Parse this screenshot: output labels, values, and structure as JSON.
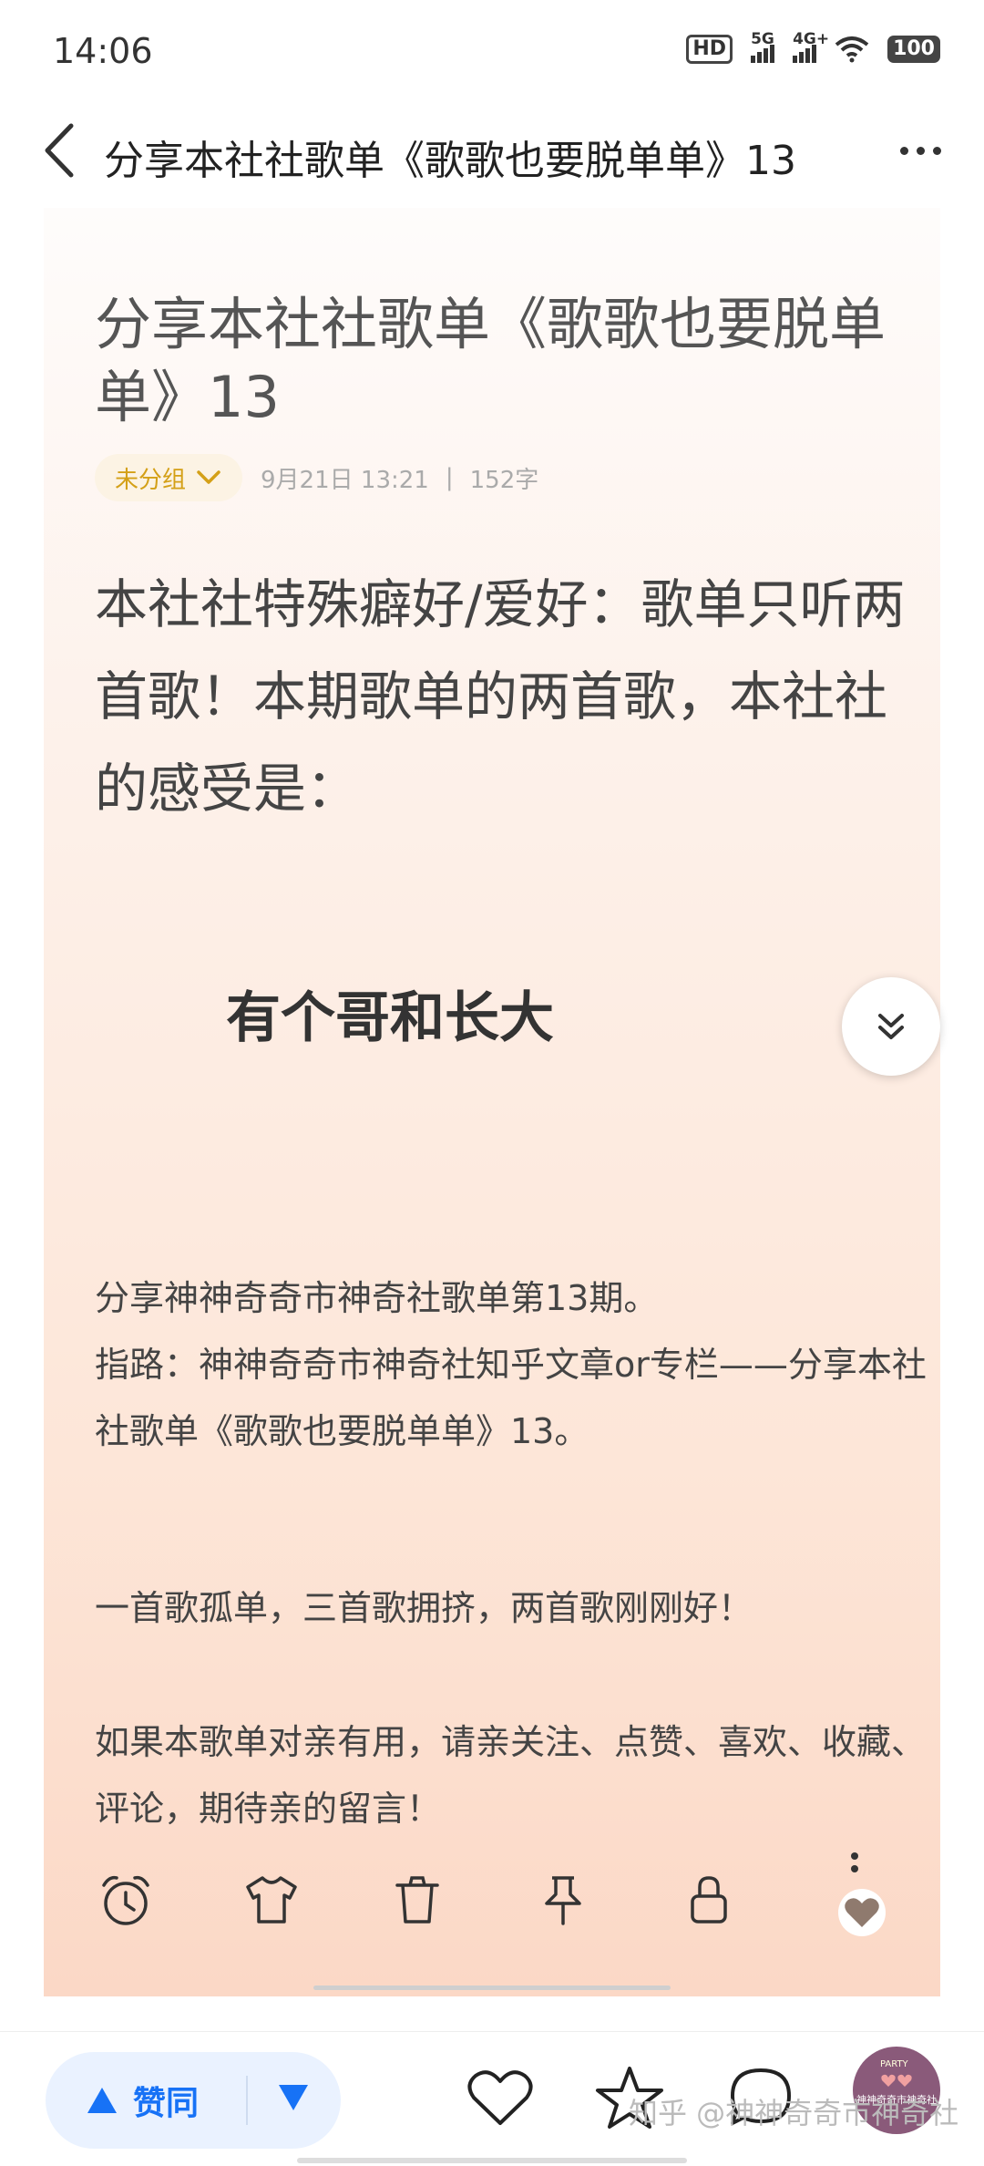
{
  "status_bar": {
    "time": "14:06",
    "hd_label": "HD",
    "signal_1": "5G",
    "signal_2": "4G+",
    "battery": "100"
  },
  "header": {
    "title": "分享本社社歌单《歌歌也要脱单单》13"
  },
  "note": {
    "title": "分享本社社歌单《歌歌也要脱单单》13",
    "group": "未分组",
    "date": "9月21日 13:21",
    "separator": "|",
    "word_count": "152字",
    "intro": "本社社特殊癖好/爱好：歌单只听两首歌！本期歌单的两首歌，本社社的感受是：",
    "song": "有个哥和长大",
    "paragraph1": "分享神神奇奇市神奇社歌单第13期。\n指路：神神奇奇市神奇社知乎文章or专栏——分享本社社歌单《歌歌也要脱单单》13。",
    "paragraph2": "一首歌孤单，三首歌拥挤，两首歌刚刚好！",
    "paragraph3": "如果本歌单对亲有用，请亲关注、点赞、喜欢、收藏、评论，期待亲的留言！"
  },
  "toolbar": {
    "icons": [
      "alarm-clock-icon",
      "tshirt-icon",
      "trash-icon",
      "pin-icon",
      "lock-icon",
      "more-vertical-icon"
    ]
  },
  "bottom_bar": {
    "upvote_label": "赞同",
    "avatar_name": "神神奇奇市神奇社",
    "avatar_tag": "PARTY",
    "watermark": "知乎 @神神奇奇市神奇社"
  },
  "colors": {
    "accent_blue": "#1772f6",
    "group_yellow": "#d4a017",
    "card_top": "#fefcfb",
    "card_bottom": "#fbd8c6"
  }
}
